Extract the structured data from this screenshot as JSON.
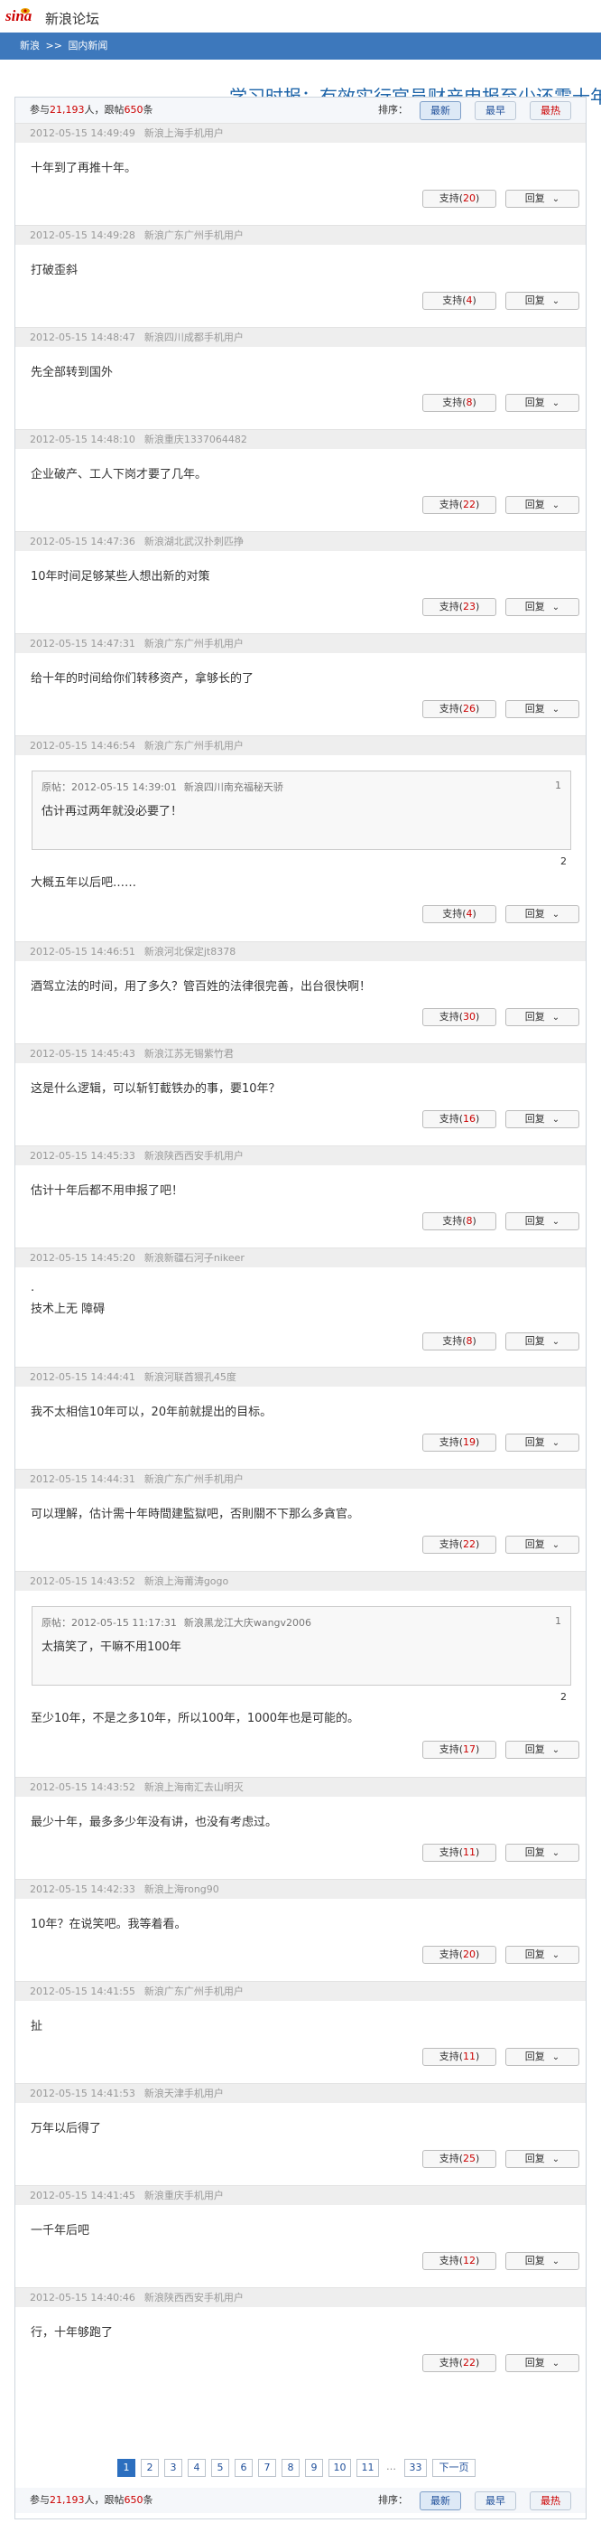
{
  "logo": {
    "brand": "sina",
    "title": "新浪论坛"
  },
  "breadcrumb": {
    "home": "新浪",
    "sep": ">>",
    "section": "国内新闻"
  },
  "page_title": "学习时报：有效实行官员财产申报至少还需十年",
  "top_bar": {
    "participants_prefix": "参与",
    "participants": "21,193",
    "participants_unit": "人，跟帖",
    "replies": "650",
    "replies_unit": "条"
  },
  "bottom_bar": {
    "participants_prefix": "参与",
    "participants": "21,193",
    "participants_unit": "人，跟帖",
    "replies": "650",
    "replies_unit": "条"
  },
  "sort": {
    "label": "排序：",
    "options": [
      "最新",
      "最早",
      "最热"
    ]
  },
  "support_label": "支持",
  "reply_label": "回复",
  "posts": [
    {
      "time": "2012-05-15 14:49:49",
      "user": "新浪上海手机用户",
      "text": "十年到了再推十年。",
      "support": "20"
    },
    {
      "time": "2012-05-15 14:49:28",
      "user": "新浪广东广州手机用户",
      "text": "打破歪斜",
      "support": "4"
    },
    {
      "time": "2012-05-15 14:48:47",
      "user": "新浪四川成都手机用户",
      "text": "先全部转到国外",
      "support": "8"
    },
    {
      "time": "2012-05-15 14:48:10",
      "user": "新浪重庆1337064482",
      "text": "企业破产、工人下岗才要了几年。",
      "support": "22"
    },
    {
      "time": "2012-05-15 14:47:36",
      "user": "新浪湖北武汉扑刺匹挣",
      "text": "10年时间足够某些人想出新的对策",
      "support": "23"
    },
    {
      "time": "2012-05-15 14:47:31",
      "user": "新浪广东广州手机用户",
      "text": "给十年的时间给你们转移资产，拿够长的了",
      "support": "26"
    },
    {
      "time": "2012-05-15 14:46:54",
      "user": "新浪广东广州手机用户",
      "quote": {
        "label": "原帖",
        "time": "2012-05-15 14:39:01",
        "user": "新浪四川南充福秘天骄",
        "text": "估计再过两年就没必要了！",
        "n": "1"
      },
      "floor": "2",
      "text": "大概五年以后吧……",
      "support": "4"
    },
    {
      "time": "2012-05-15 14:46:51",
      "user": "新浪河北保定jt8378",
      "text": "酒驾立法的时间，用了多久？管百姓的法律很完善，出台很快啊！",
      "support": "30"
    },
    {
      "time": "2012-05-15 14:45:43",
      "user": "新浪江苏无锡紫竹君",
      "text": "这是什么逻辑，可以斩钉截铁办的事，要10年？",
      "support": "16"
    },
    {
      "time": "2012-05-15 14:45:33",
      "user": "新浪陕西西安手机用户",
      "text": "估计十年后都不用申报了吧！",
      "support": "8"
    },
    {
      "time": "2012-05-15 14:45:20",
      "user": "新浪新疆石河子nikeer",
      "dot": ".",
      "text": "技术上无 障碍",
      "support": "8"
    },
    {
      "time": "2012-05-15 14:44:41",
      "user": "新浪河联酋猥孔45度",
      "text": "我不太相信10年可以，20年前就提出的目标。",
      "support": "19"
    },
    {
      "time": "2012-05-15 14:44:31",
      "user": "新浪广东广州手机用户",
      "text": "可以理解，估计需十年時間建監獄吧，否則關不下那么多貪官。",
      "support": "22"
    },
    {
      "time": "2012-05-15 14:43:52",
      "user": "新浪上海莆涛gogo",
      "quote": {
        "label": "原帖",
        "time": "2012-05-15 11:17:31",
        "user": "新浪黑龙江大庆wangv2006",
        "text": "太搞笑了，干嘛不用100年",
        "n": "1"
      },
      "floor": "2",
      "text": "至少10年，不是之多10年，所以100年，1000年也是可能的。",
      "support": "17"
    },
    {
      "time": "2012-05-15 14:43:52",
      "user": "新浪上海南汇去山明灭",
      "text": "最少十年，最多多少年没有讲，也没有考虑过。",
      "support": "11"
    },
    {
      "time": "2012-05-15 14:42:33",
      "user": "新浪上海rong90",
      "text": "10年？在说笑吧。我等着看。",
      "support": "20"
    },
    {
      "time": "2012-05-15 14:41:55",
      "user": "新浪广东广州手机用户",
      "text": "扯",
      "support": "11"
    },
    {
      "time": "2012-05-15 14:41:53",
      "user": "新浪天津手机用户",
      "text": "万年以后得了",
      "support": "25"
    },
    {
      "time": "2012-05-15 14:41:45",
      "user": "新浪重庆手机用户",
      "text": "一千年后吧",
      "support": "12"
    },
    {
      "time": "2012-05-15 14:40:46",
      "user": "新浪陕西西安手机用户",
      "text": "行，十年够跑了",
      "support": "22"
    }
  ],
  "pagination": {
    "pages": [
      "1",
      "2",
      "3",
      "4",
      "5",
      "6",
      "7",
      "8",
      "9",
      "10",
      "11"
    ],
    "current": "1",
    "ellipsis": "…",
    "last": "33",
    "next": "下一页"
  }
}
